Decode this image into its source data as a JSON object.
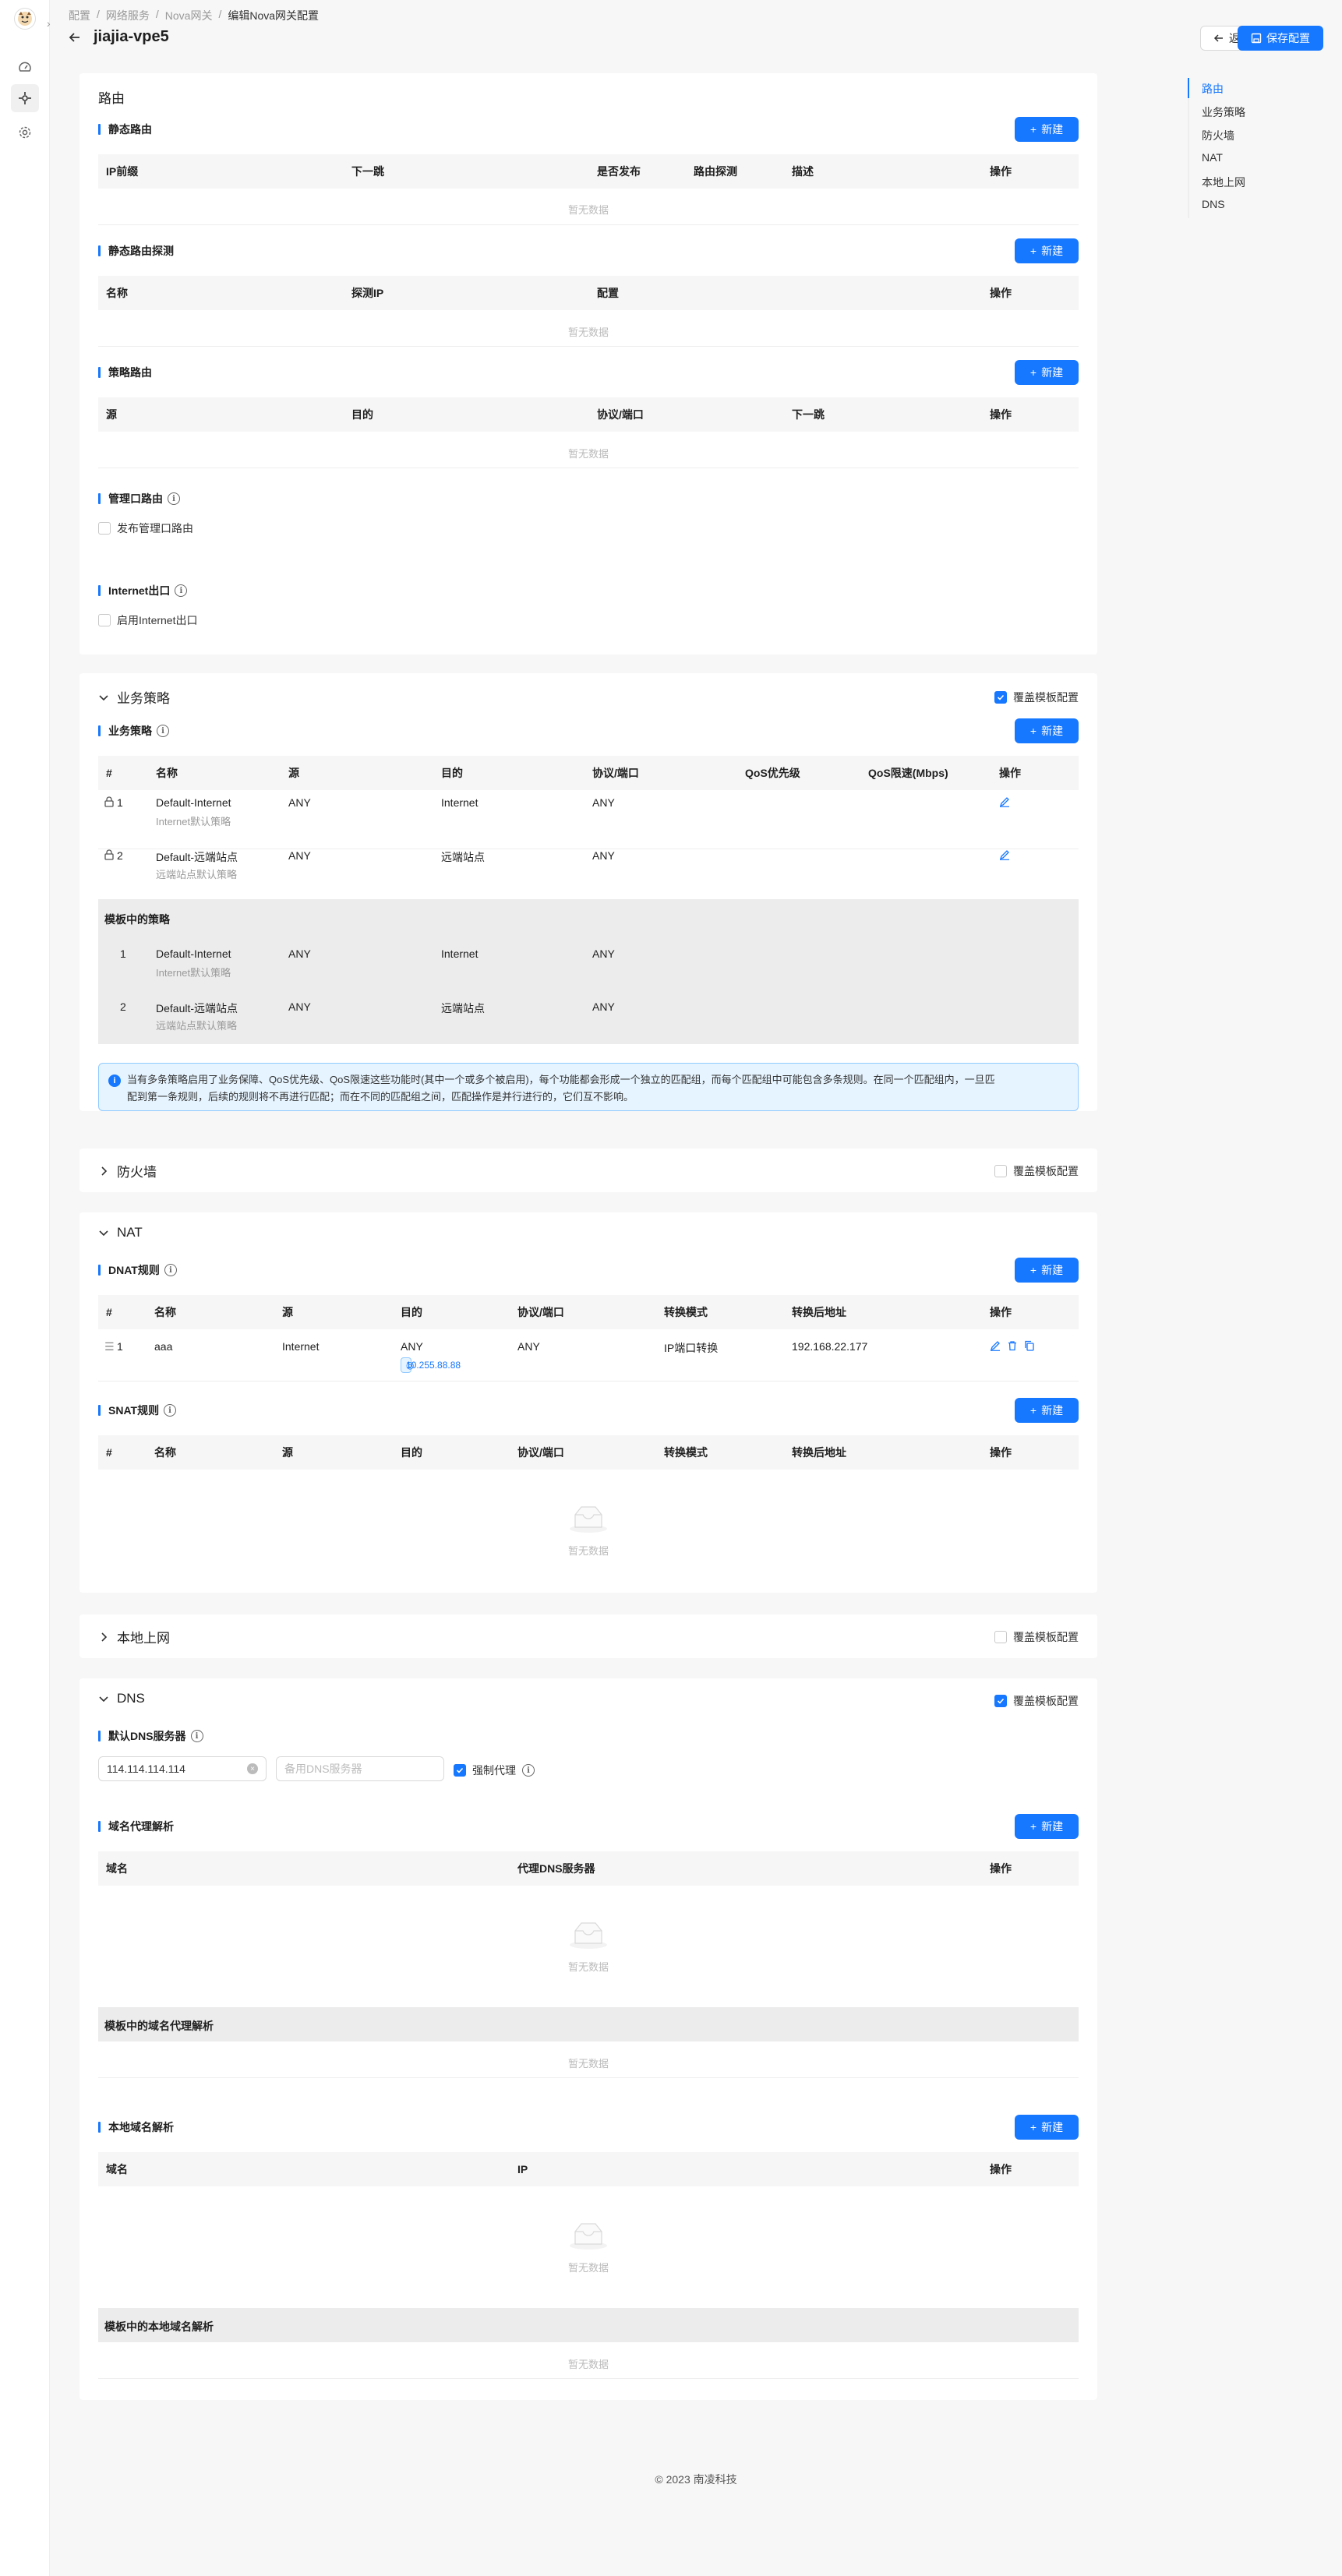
{
  "breadcrumb": {
    "items": [
      "配置",
      "网络服务",
      "Nova网关"
    ],
    "current": "编辑Nova网关配置",
    "sep": "/"
  },
  "page": {
    "title": "jiajia-vpe5",
    "back_label": "返回",
    "save_label": "保存配置"
  },
  "anchor_nav": [
    "路由",
    "业务策略",
    "防火墙",
    "NAT",
    "本地上网",
    "DNS"
  ],
  "common": {
    "new_label": "新建",
    "empty_text": "暂无数据",
    "override_label": "覆盖模板配置",
    "edit_icon": "edit-icon",
    "lock_icon": "lock-icon"
  },
  "routing": {
    "title": "路由",
    "static": {
      "title": "静态路由",
      "columns": [
        "IP前缀",
        "下一跳",
        "是否发布",
        "路由探测",
        "描述",
        "操作"
      ]
    },
    "probe": {
      "title": "静态路由探测",
      "columns": [
        "名称",
        "探测IP",
        "配置",
        "操作"
      ]
    },
    "policy": {
      "title": "策略路由",
      "columns": [
        "源",
        "目的",
        "协议/端口",
        "下一跳",
        "操作"
      ]
    },
    "mgmt": {
      "title": "管理口路由",
      "checkbox": "发布管理口路由"
    },
    "internet": {
      "title": "Internet出口",
      "checkbox": "启用Internet出口"
    }
  },
  "business": {
    "title": "业务策略",
    "override": true,
    "sub_title": "业务策略",
    "columns": [
      "#",
      "名称",
      "源",
      "目的",
      "协议/端口",
      "QoS优先级",
      "QoS限速(Mbps)",
      "操作"
    ],
    "rows": [
      {
        "no": "1",
        "name": "Default-Internet",
        "desc": "Internet默认策略",
        "src": "ANY",
        "dst": "Internet",
        "proto": "ANY"
      },
      {
        "no": "2",
        "name": "Default-远端站点",
        "desc": "远端站点默认策略",
        "src": "ANY",
        "dst": "远端站点",
        "proto": "ANY"
      }
    ],
    "template_title": "模板中的策略",
    "template_rows": [
      {
        "no": "1",
        "name": "Default-Internet",
        "desc": "Internet默认策略",
        "src": "ANY",
        "dst": "Internet",
        "proto": "ANY"
      },
      {
        "no": "2",
        "name": "Default-远端站点",
        "desc": "远端站点默认策略",
        "src": "ANY",
        "dst": "远端站点",
        "proto": "ANY"
      }
    ],
    "alert_line1": "当有多条策略启用了业务保障、QoS优先级、QoS限速这些功能时(其中一个或多个被启用)，每个功能都会形成一个独立的匹配组，而每个匹配组中可能包含多条规则。在同一个匹配组内，一旦匹",
    "alert_line2": "配到第一条规则，后续的规则将不再进行匹配；而在不同的匹配组之间，匹配操作是并行进行的，它们互不影响。"
  },
  "firewall": {
    "title": "防火墙",
    "override": false
  },
  "nat": {
    "title": "NAT",
    "dnat": {
      "title": "DNAT规则",
      "columns": [
        "#",
        "名称",
        "源",
        "目的",
        "协议/端口",
        "转换模式",
        "转换后地址",
        "操作"
      ],
      "rows": [
        {
          "no": "1",
          "name": "aaa",
          "src": "Internet",
          "dst": "ANY",
          "dst_tag": "10.255.88.88",
          "proto": "ANY",
          "mode": "IP端口转换",
          "addr": "192.168.22.177"
        }
      ]
    },
    "snat": {
      "title": "SNAT规则",
      "columns": [
        "#",
        "名称",
        "源",
        "目的",
        "协议/端口",
        "转换模式",
        "转换后地址",
        "操作"
      ]
    }
  },
  "local": {
    "title": "本地上网",
    "override": false
  },
  "dns": {
    "title": "DNS",
    "override": true,
    "default_title": "默认DNS服务器",
    "primary_value": "114.114.114.114",
    "secondary_placeholder": "备用DNS服务器",
    "force_proxy": "强制代理",
    "proxy": {
      "title": "域名代理解析",
      "columns": [
        "域名",
        "代理DNS服务器",
        "操作"
      ],
      "template_title": "模板中的域名代理解析"
    },
    "local": {
      "title": "本地域名解析",
      "columns": [
        "域名",
        "IP",
        "操作"
      ],
      "template_title": "模板中的本地域名解析"
    }
  },
  "footer": "© 2023 南凌科技"
}
